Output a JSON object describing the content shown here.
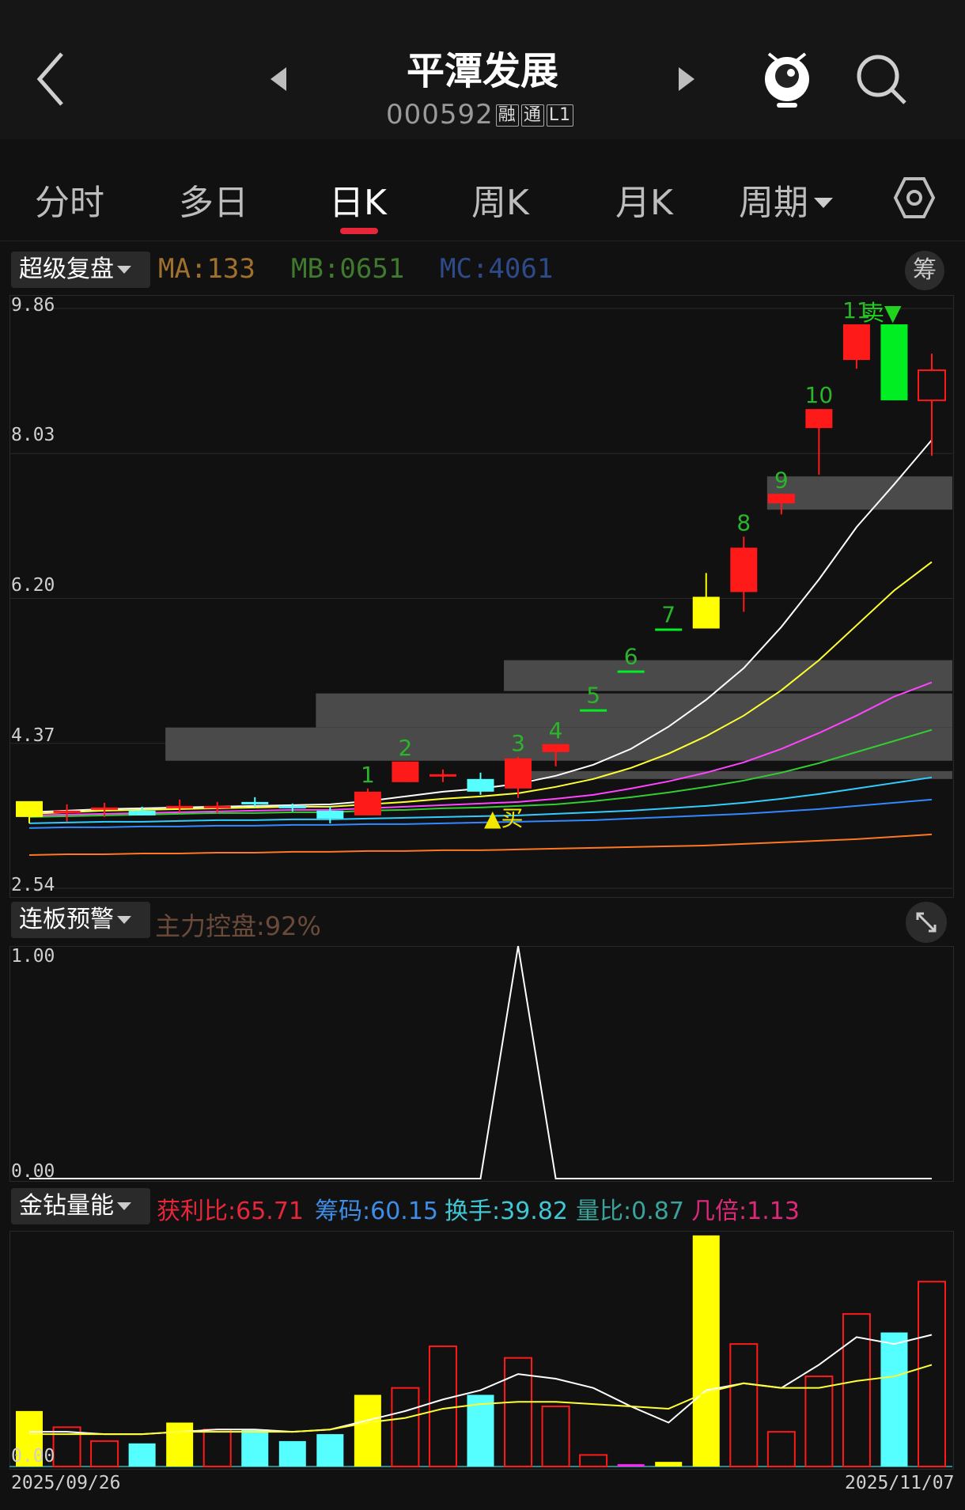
{
  "header": {
    "title": "平潭发展",
    "code": "000592",
    "tags": [
      "融",
      "通",
      "L1"
    ]
  },
  "tabs": [
    {
      "label": "分时"
    },
    {
      "label": "多日"
    },
    {
      "label": "日K",
      "active": true
    },
    {
      "label": "周K"
    },
    {
      "label": "月K"
    },
    {
      "label": "周期"
    }
  ],
  "main_panel": {
    "dropdown": "超级复盘",
    "indicators": [
      {
        "text": "MA:133",
        "color": "#a0712d"
      },
      {
        "text": "MB:0651",
        "color": "#3f7a2e"
      },
      {
        "text": "MC:4061",
        "color": "#2e4a8a"
      }
    ],
    "chip_button": "筹",
    "y_labels": [
      "9.86",
      "8.03",
      "6.20",
      "4.37",
      "2.54"
    ],
    "buy_label": "▲买",
    "sell_label": "卖▼"
  },
  "warn_panel": {
    "dropdown": "连板预警",
    "label": "主力控盘:92%",
    "y_labels": [
      "1.00",
      "0.00"
    ]
  },
  "volume_panel": {
    "dropdown": "金钻量能",
    "stats": [
      {
        "text": "获利比:65.71",
        "color": "#e8263a"
      },
      {
        "text": "筹码:60.15",
        "color": "#3e8ee8"
      },
      {
        "text": "换手:39.82",
        "color": "#3fc7d6"
      },
      {
        "text": "量比:0.87",
        "color": "#3aa39c"
      },
      {
        "text": "几倍:1.13",
        "color": "#e0287a"
      }
    ],
    "y_label": "0.00"
  },
  "dates": {
    "start": "2025/09/26",
    "end": "2025/11/07"
  },
  "chart_data": [
    {
      "type": "candlestick",
      "ylim": [
        2.54,
        9.86
      ],
      "y_ticks": [
        9.86,
        8.03,
        6.2,
        4.37,
        2.54
      ],
      "x": [
        "2025/09/26",
        "",
        "",
        "",
        "",
        "",
        "",
        "",
        "",
        "",
        "",
        "",
        "",
        "",
        "",
        "",
        "",
        "",
        "",
        "",
        "",
        "",
        "",
        "",
        "",
        "2025/11/07"
      ],
      "candles": [
        {
          "o": 3.44,
          "h": 3.56,
          "l": 3.36,
          "c": 3.64,
          "color": "yellow"
        },
        {
          "o": 3.52,
          "h": 3.6,
          "l": 3.38,
          "c": 3.5,
          "color": "red"
        },
        {
          "o": 3.55,
          "h": 3.62,
          "l": 3.44,
          "c": 3.56,
          "color": "red"
        },
        {
          "o": 3.52,
          "h": 3.57,
          "l": 3.46,
          "c": 3.46,
          "color": "cyan"
        },
        {
          "o": 3.56,
          "h": 3.66,
          "l": 3.5,
          "c": 3.58,
          "color": "red"
        },
        {
          "o": 3.56,
          "h": 3.63,
          "l": 3.49,
          "c": 3.58,
          "color": "red"
        },
        {
          "o": 3.63,
          "h": 3.69,
          "l": 3.57,
          "c": 3.6,
          "color": "cyan"
        },
        {
          "o": 3.58,
          "h": 3.61,
          "l": 3.51,
          "c": 3.56,
          "color": "cyan"
        },
        {
          "o": 3.52,
          "h": 3.57,
          "l": 3.36,
          "c": 3.42,
          "color": "cyan"
        },
        {
          "o": 3.46,
          "h": 3.8,
          "l": 3.46,
          "c": 3.76,
          "color": "red",
          "label": "1"
        },
        {
          "o": 3.88,
          "h": 4.14,
          "l": 3.88,
          "c": 4.14,
          "color": "red",
          "label": "2"
        },
        {
          "o": 3.98,
          "h": 4.04,
          "l": 3.88,
          "c": 3.96,
          "color": "red"
        },
        {
          "o": 3.92,
          "h": 4.0,
          "l": 3.72,
          "c": 3.76,
          "color": "cyan"
        },
        {
          "o": 3.8,
          "h": 4.2,
          "l": 3.68,
          "c": 4.18,
          "color": "red",
          "label": "3"
        },
        {
          "o": 4.26,
          "h": 4.36,
          "l": 4.08,
          "c": 4.36,
          "color": "red",
          "label": "4"
        },
        {
          "o": 4.78,
          "h": 4.8,
          "l": 4.78,
          "c": 4.8,
          "color": "green",
          "label": "5"
        },
        {
          "o": 5.27,
          "h": 5.29,
          "l": 5.27,
          "c": 5.29,
          "color": "green",
          "label": "6"
        },
        {
          "o": 5.8,
          "h": 5.82,
          "l": 5.8,
          "c": 5.82,
          "color": "green",
          "label": "7"
        },
        {
          "o": 6.22,
          "h": 6.52,
          "l": 5.95,
          "c": 5.82,
          "color": "yellow"
        },
        {
          "o": 6.28,
          "h": 6.98,
          "l": 6.03,
          "c": 6.84,
          "color": "red",
          "label": "8"
        },
        {
          "o": 7.4,
          "h": 7.52,
          "l": 7.26,
          "c": 7.52,
          "color": "red",
          "label": "9"
        },
        {
          "o": 8.35,
          "h": 8.59,
          "l": 7.76,
          "c": 8.59,
          "color": "red",
          "label": "10"
        },
        {
          "o": 9.21,
          "h": 9.66,
          "l": 9.1,
          "c": 9.66,
          "color": "red",
          "label": "11"
        },
        {
          "o": 9.66,
          "h": 9.66,
          "l": 8.7,
          "c": 8.7,
          "color": "green"
        },
        {
          "o": 8.7,
          "h": 9.29,
          "l": 8.0,
          "c": 9.08,
          "color": "hollow-red"
        }
      ]
    },
    {
      "type": "line",
      "ylim": [
        0,
        1
      ],
      "y_ticks": [
        1.0,
        0.0
      ],
      "series": [
        {
          "values": [
            0,
            0,
            0,
            0,
            0,
            0,
            0,
            0,
            0,
            0,
            0,
            0,
            0,
            1,
            0,
            0,
            0,
            0,
            0,
            0,
            0,
            0,
            0,
            0,
            0
          ]
        }
      ]
    },
    {
      "type": "bar",
      "y_ticks": [
        0.0
      ],
      "values": [
        2.4,
        1.7,
        1.1,
        1.0,
        1.9,
        1.6,
        1.6,
        1.1,
        1.4,
        3.1,
        3.4,
        5.2,
        3.1,
        4.7,
        2.6,
        0.5,
        0.1,
        0.2,
        10.0,
        5.3,
        1.5,
        3.9,
        6.6,
        5.8,
        8.0
      ],
      "colors": [
        "yellow",
        "red",
        "red",
        "cyan",
        "yellow",
        "red",
        "cyan",
        "cyan",
        "cyan",
        "yellow",
        "red",
        "red",
        "cyan",
        "red",
        "red",
        "red",
        "magenta",
        "yellow",
        "yellow",
        "red",
        "red",
        "red",
        "red",
        "cyan",
        "red"
      ]
    }
  ]
}
